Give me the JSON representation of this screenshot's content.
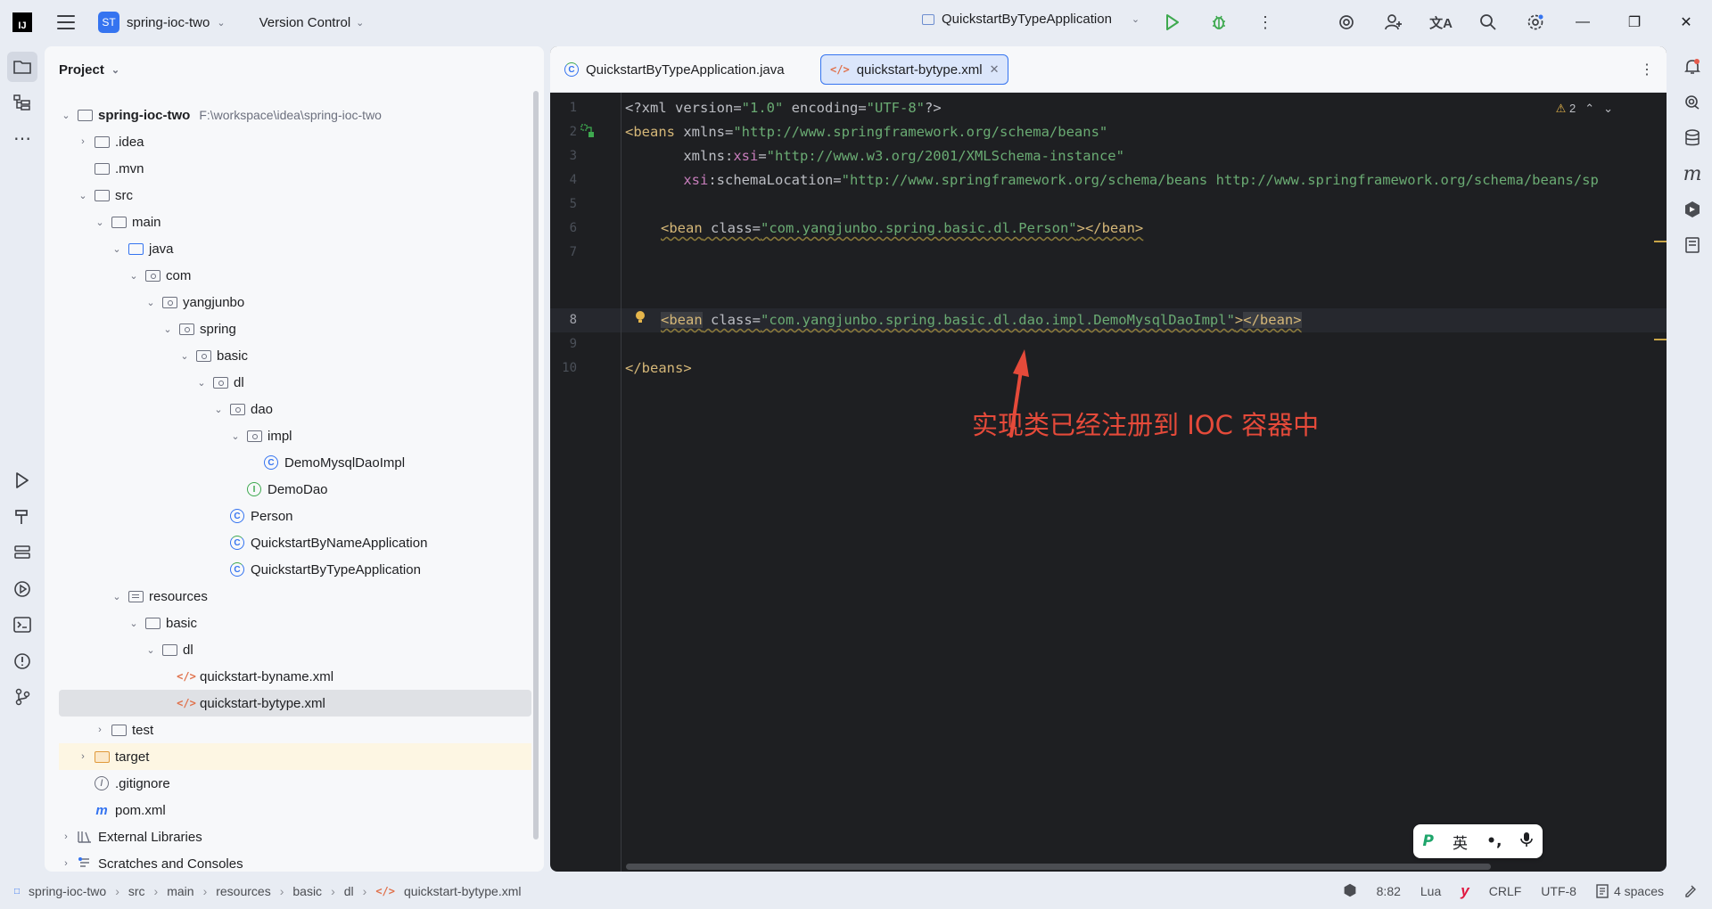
{
  "titlebar": {
    "logo_text": "IJ",
    "project_badge": "ST",
    "project_name": "spring-ioc-two",
    "vcs_label": "Version Control",
    "run_config": "QuickstartByTypeApplication",
    "window_controls": [
      "minimize-icon",
      "restore-icon",
      "close-icon"
    ]
  },
  "project_panel": {
    "title": "Project",
    "tree": [
      {
        "label": "spring-ioc-two",
        "path": "F:\\workspace\\idea\\spring-ioc-two",
        "icon": "module-folder-icon"
      },
      {
        "label": ".idea",
        "icon": "folder-icon"
      },
      {
        "label": ".mvn",
        "icon": "folder-icon"
      },
      {
        "label": "src",
        "icon": "folder-icon"
      },
      {
        "label": "main",
        "icon": "folder-icon"
      },
      {
        "label": "java",
        "icon": "source-folder-icon"
      },
      {
        "label": "com",
        "icon": "package-icon"
      },
      {
        "label": "yangjunbo",
        "icon": "package-icon"
      },
      {
        "label": "spring",
        "icon": "package-icon"
      },
      {
        "label": "basic",
        "icon": "package-icon"
      },
      {
        "label": "dl",
        "icon": "package-icon"
      },
      {
        "label": "dao",
        "icon": "package-icon"
      },
      {
        "label": "impl",
        "icon": "package-icon"
      },
      {
        "label": "DemoMysqlDaoImpl",
        "icon": "class-icon"
      },
      {
        "label": "DemoDao",
        "icon": "interface-icon"
      },
      {
        "label": "Person",
        "icon": "class-icon"
      },
      {
        "label": "QuickstartByNameApplication",
        "icon": "spring-class-icon"
      },
      {
        "label": "QuickstartByTypeApplication",
        "icon": "spring-class-icon"
      },
      {
        "label": "resources",
        "icon": "resources-folder-icon"
      },
      {
        "label": "basic",
        "icon": "folder-icon"
      },
      {
        "label": "dl",
        "icon": "folder-icon"
      },
      {
        "label": "quickstart-byname.xml",
        "icon": "xml-file-icon"
      },
      {
        "label": "quickstart-bytype.xml",
        "icon": "xml-file-icon"
      },
      {
        "label": "test",
        "icon": "folder-icon"
      },
      {
        "label": "target",
        "icon": "excluded-folder-icon"
      },
      {
        "label": ".gitignore",
        "icon": "ignore-file-icon"
      },
      {
        "label": "pom.xml",
        "icon": "maven-icon"
      },
      {
        "label": "External Libraries",
        "icon": "library-icon"
      },
      {
        "label": "Scratches and Consoles",
        "icon": "scratch-icon"
      }
    ]
  },
  "editor": {
    "tabs": [
      {
        "label": "QuickstartByTypeApplication.java",
        "active": false
      },
      {
        "label": "quickstart-bytype.xml",
        "active": true
      }
    ],
    "warning_count": "2",
    "line_numbers": [
      "1",
      "2",
      "3",
      "4",
      "5",
      "6",
      "7",
      "8",
      "9",
      "10"
    ],
    "current_line": 8,
    "code": {
      "l1": {
        "a": "<?xml version=",
        "b": "\"1.0\"",
        "c": " encoding=",
        "d": "\"UTF-8\"",
        "e": "?>"
      },
      "l2": {
        "a": "<beans",
        "b": " xmlns=",
        "c": "\"http://www.springframework.org/schema/beans\""
      },
      "l3": {
        "a": "       xmlns:",
        "b": "xsi",
        "c": "=",
        "d": "\"http://www.w3.org/2001/XMLSchema-instance\""
      },
      "l4": {
        "a": "       ",
        "b": "xsi",
        "c": ":schemaLocation=",
        "d": "\"http://www.springframework.org/schema/beans http://www.springframework.org/schema/beans/sp"
      },
      "l6": {
        "a": "<bean",
        "b": " class=",
        "c": "\"com.yangjunbo.spring.basic.dl.Person\"",
        "d": "></bean>"
      },
      "l8": {
        "a": "<bean",
        "b": " class=",
        "c": "\"com.yangjunbo.spring.basic.dl.dao.impl.DemoMysqlDaoImpl\"",
        "d": ">",
        "e": "</bean>"
      },
      "l10": {
        "a": "</beans>"
      }
    },
    "annotation": "实现类已经注册到 IOC 容器中"
  },
  "ime": {
    "logo": "P",
    "mode": "英",
    "punct": "•,",
    "mic": "mic-icon"
  },
  "statusbar": {
    "breadcrumb": [
      "spring-ioc-two",
      "src",
      "main",
      "resources",
      "basic",
      "dl",
      "quickstart-bytype.xml"
    ],
    "position": "8:82",
    "lang": "Lua",
    "line_sep": "CRLF",
    "encoding": "UTF-8",
    "indent": "4 spaces"
  }
}
